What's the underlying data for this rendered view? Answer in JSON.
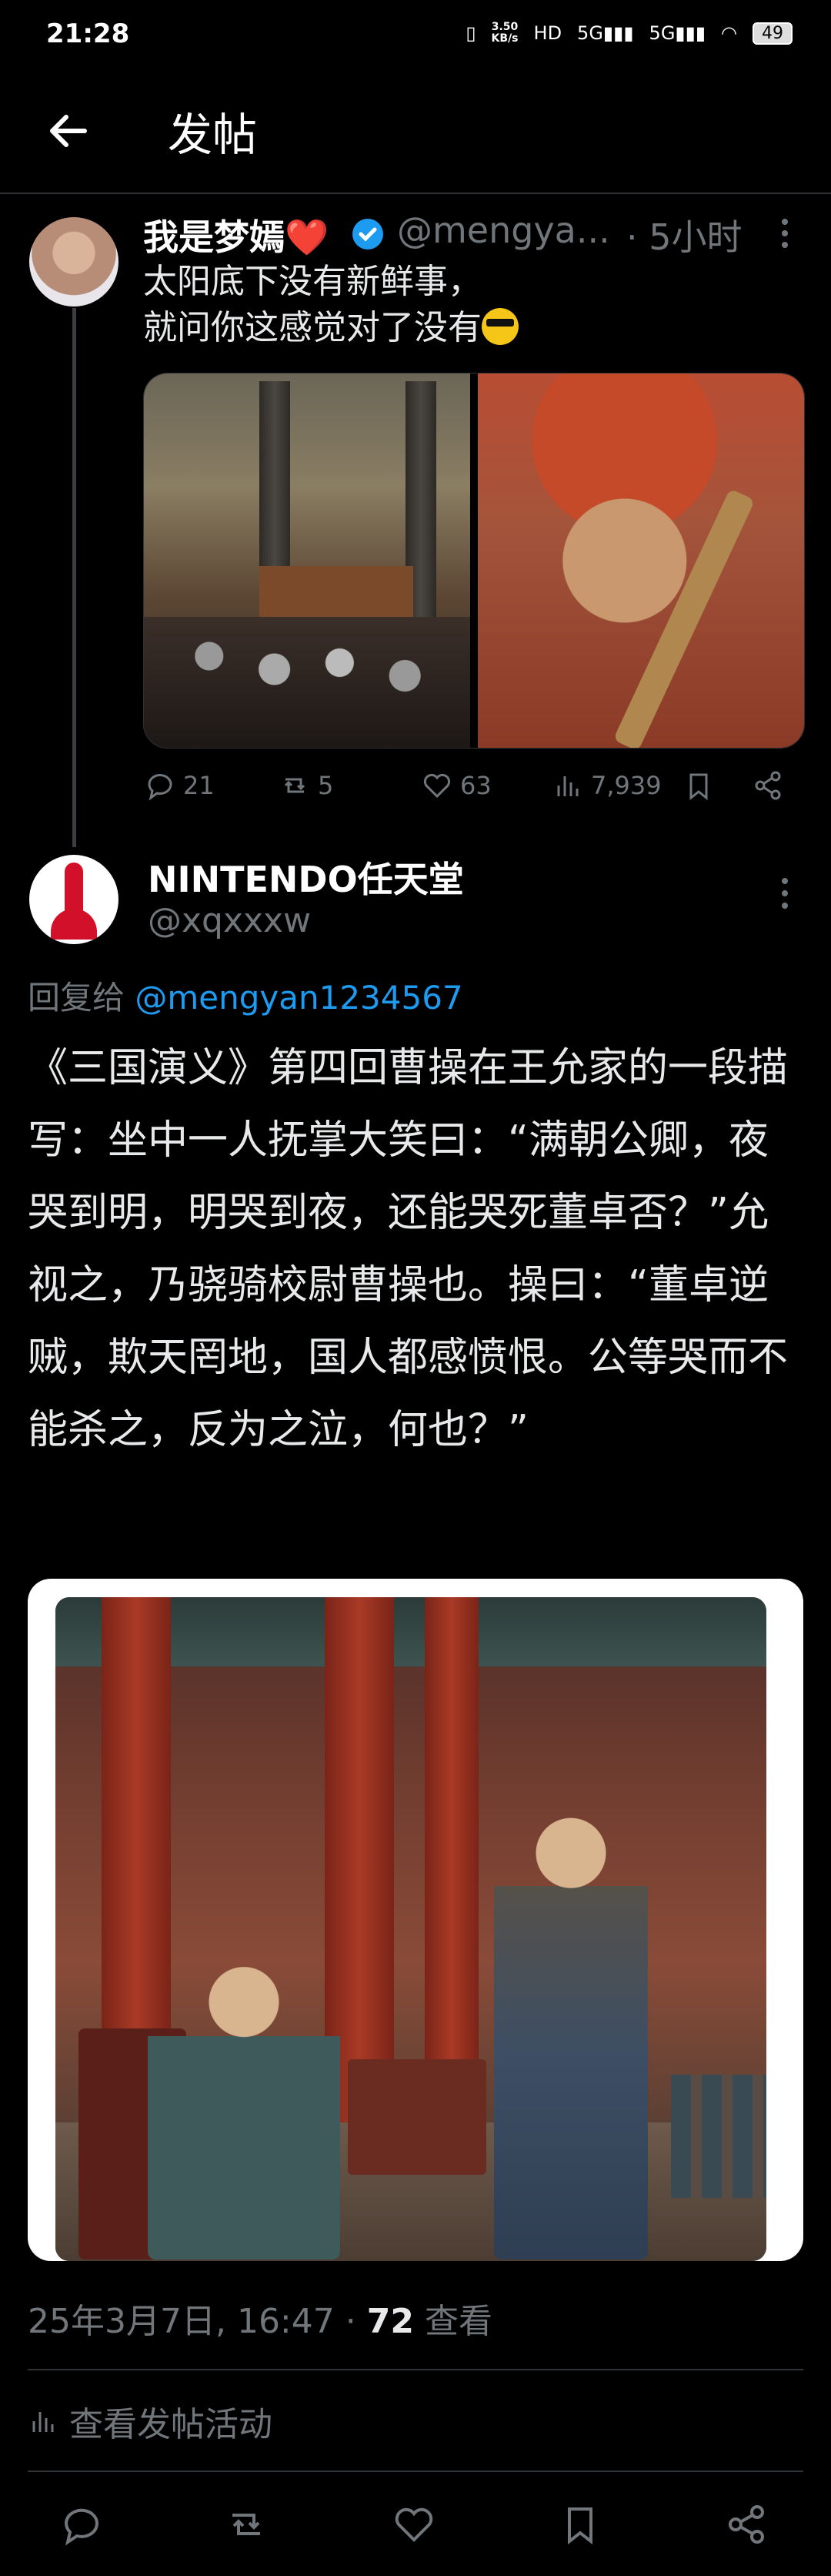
{
  "status_bar": {
    "time": "21:28",
    "net_speed": "3.50",
    "net_unit": "KB/s",
    "battery": "49"
  },
  "header": {
    "title": "发帖"
  },
  "tweet1": {
    "name": "我是梦嫣",
    "name_emoji": "❤️",
    "handle": "@mengya...",
    "time": "· 5小时",
    "text": "太阳底下没有新鲜事，\n就问你这感觉对了没有",
    "emoji": "😎",
    "replies": "21",
    "retweets": "5",
    "likes": "63",
    "views": "7,939"
  },
  "tweet2": {
    "name": "NINTENDO任天堂",
    "handle": "@xqxxxw",
    "reply_prefix": "回复给 ",
    "reply_to": "@mengyan1234567",
    "body": "《三国演义》第四回曹操在王允家的一段描写：坐中一人抚掌大笑曰：“满朝公卿，夜哭到明，明哭到夜，还能哭死董卓否？”允视之，乃骁骑校尉曹操也。操曰：“董卓逆贼，欺天罔地，国人都感愤恨。公等哭而不能杀之，反为之泣，何也？”",
    "timestamp": "25年3月7日, 16:47 · ",
    "views_count": "72",
    "views_label": " 查看",
    "activity_label": "查看发帖活动"
  },
  "colors": {
    "link": "#1d9bf0",
    "muted": "#71767b",
    "verified": "#1d9bf0",
    "like_red": "#e0245e"
  },
  "icons": [
    "back-arrow-icon",
    "verified-badge-icon",
    "more-icon",
    "reply-icon",
    "retweet-icon",
    "like-icon",
    "views-icon",
    "bookmark-icon",
    "share-icon"
  ]
}
